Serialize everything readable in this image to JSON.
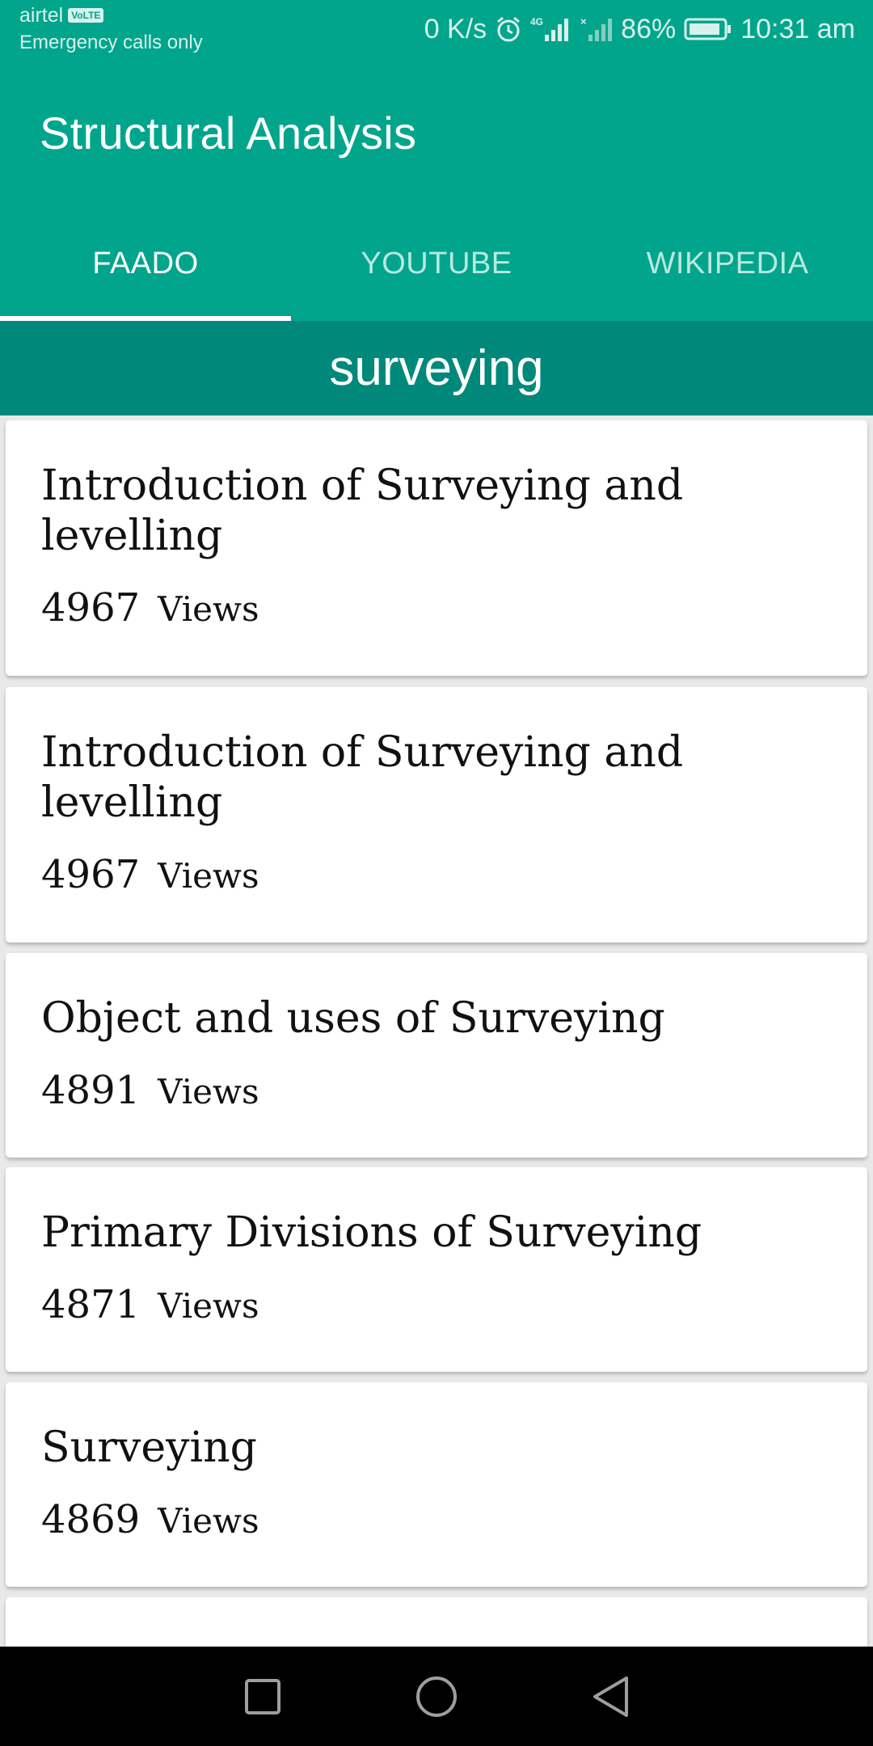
{
  "status_bar": {
    "carrier": "airtel",
    "volte": "VoLTE",
    "emergency": "Emergency calls only",
    "net_speed": "0 K/s",
    "network": "4G",
    "battery": "86%",
    "time": "10:31 am"
  },
  "app": {
    "title": "Structural Analysis",
    "accent_color": "#00a58c",
    "category_color": "#00897b"
  },
  "tabs": [
    {
      "label": "FAADO",
      "active": true
    },
    {
      "label": "YOUTUBE",
      "active": false
    },
    {
      "label": "WIKIPEDIA",
      "active": false
    }
  ],
  "category": {
    "label": "surveying"
  },
  "items": [
    {
      "title": "Introduction of Surveying and levelling",
      "views": "4967",
      "views_label": "Views"
    },
    {
      "title": "Introduction of Surveying and levelling",
      "views": "4967",
      "views_label": "Views"
    },
    {
      "title": "Object and uses of Surveying",
      "views": "4891",
      "views_label": "Views"
    },
    {
      "title": "Primary Divisions of Surveying",
      "views": "4871",
      "views_label": "Views"
    },
    {
      "title": "Surveying",
      "views": "4869",
      "views_label": "Views"
    }
  ],
  "nav_bar": {
    "buttons": [
      "recent-apps-icon",
      "home-icon",
      "back-icon"
    ]
  }
}
